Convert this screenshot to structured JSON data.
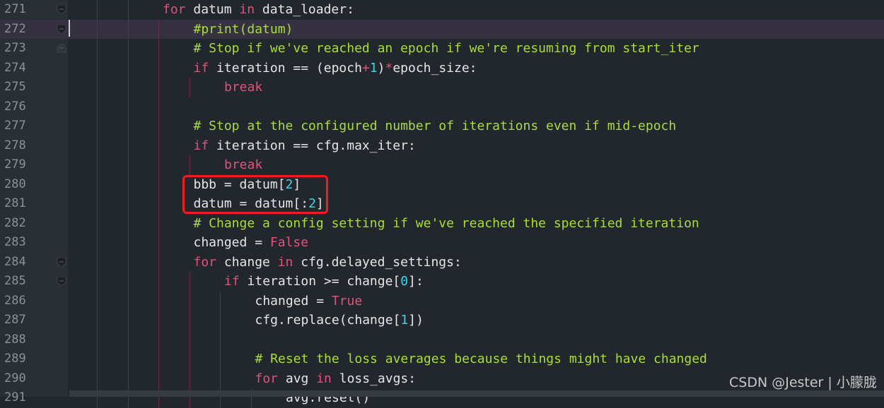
{
  "editor": {
    "active_line": 272,
    "lines": [
      {
        "n": 271,
        "indent": 3,
        "fold": "open",
        "tokens": [
          [
            "kw",
            "for"
          ],
          [
            "tx",
            " datum "
          ],
          [
            "kw",
            "in"
          ],
          [
            "tx",
            " data_loader:"
          ]
        ]
      },
      {
        "n": 272,
        "indent": 4,
        "fold": "open",
        "tokens": [
          [
            "cm",
            "#print(datum)"
          ]
        ]
      },
      {
        "n": 273,
        "indent": 4,
        "fold": "end",
        "tokens": [
          [
            "cm",
            "# Stop if we've reached an epoch if we're resuming from start_iter"
          ]
        ]
      },
      {
        "n": 274,
        "indent": 4,
        "tokens": [
          [
            "kw",
            "if"
          ],
          [
            "tx",
            " iteration == (epoch"
          ],
          [
            "kw",
            "+"
          ],
          [
            "nm",
            "1"
          ],
          [
            "tx",
            ")"
          ],
          [
            "kw",
            "*"
          ],
          [
            "tx",
            "epoch_size:"
          ]
        ]
      },
      {
        "n": 275,
        "indent": 5,
        "tokens": [
          [
            "kw",
            "break"
          ]
        ]
      },
      {
        "n": 276,
        "indent": 4,
        "tokens": []
      },
      {
        "n": 277,
        "indent": 4,
        "tokens": [
          [
            "cm",
            "# Stop at the configured number of iterations even if mid-epoch"
          ]
        ]
      },
      {
        "n": 278,
        "indent": 4,
        "tokens": [
          [
            "kw",
            "if"
          ],
          [
            "tx",
            " iteration == cfg.max_iter:"
          ]
        ]
      },
      {
        "n": 279,
        "indent": 5,
        "tokens": [
          [
            "kw",
            "break"
          ]
        ]
      },
      {
        "n": 280,
        "indent": 4,
        "tokens": [
          [
            "tx",
            "bbb = datum["
          ],
          [
            "nm",
            "2"
          ],
          [
            "tx",
            "]"
          ]
        ]
      },
      {
        "n": 281,
        "indent": 4,
        "tokens": [
          [
            "tx",
            "datum = datum[:"
          ],
          [
            "nm",
            "2"
          ],
          [
            "tx",
            "]"
          ]
        ]
      },
      {
        "n": 282,
        "indent": 4,
        "tokens": [
          [
            "cm",
            "# Change a config setting if we've reached the specified iteration"
          ]
        ]
      },
      {
        "n": 283,
        "indent": 4,
        "tokens": [
          [
            "tx",
            "changed = "
          ],
          [
            "kw",
            "False"
          ]
        ]
      },
      {
        "n": 284,
        "indent": 4,
        "fold": "open",
        "tokens": [
          [
            "kw",
            "for"
          ],
          [
            "tx",
            " change "
          ],
          [
            "kw",
            "in"
          ],
          [
            "tx",
            " cfg.delayed_settings:"
          ]
        ]
      },
      {
        "n": 285,
        "indent": 5,
        "fold": "open",
        "tokens": [
          [
            "kw",
            "if"
          ],
          [
            "tx",
            " iteration >= change["
          ],
          [
            "nm",
            "0"
          ],
          [
            "tx",
            "]:"
          ]
        ]
      },
      {
        "n": 286,
        "indent": 6,
        "tokens": [
          [
            "tx",
            "changed = "
          ],
          [
            "kw",
            "True"
          ]
        ]
      },
      {
        "n": 287,
        "indent": 6,
        "tokens": [
          [
            "tx",
            "cfg.replace(change["
          ],
          [
            "nm",
            "1"
          ],
          [
            "tx",
            "])"
          ]
        ]
      },
      {
        "n": 288,
        "indent": 6,
        "tokens": []
      },
      {
        "n": 289,
        "indent": 6,
        "tokens": [
          [
            "cm",
            "# Reset the loss averages because things might have changed"
          ]
        ]
      },
      {
        "n": 290,
        "indent": 6,
        "tokens": [
          [
            "kw",
            "for"
          ],
          [
            "tx",
            " avg "
          ],
          [
            "kw",
            "in"
          ],
          [
            "tx",
            " loss_avgs:"
          ]
        ]
      },
      {
        "n": 291,
        "indent": 7,
        "tokens": [
          [
            "tx",
            "avg.reset()"
          ]
        ]
      }
    ]
  },
  "annotation": {
    "box_color": "#f01d1d",
    "highlighted_lines": [
      280,
      281
    ]
  },
  "watermark": "CSDN @Jester | 小朦胧",
  "colors": {
    "background": "#22262d",
    "keyword": "#e5507a",
    "comment": "#a9dc3c",
    "number": "#3fd6e3",
    "text": "#e6e6e6"
  }
}
